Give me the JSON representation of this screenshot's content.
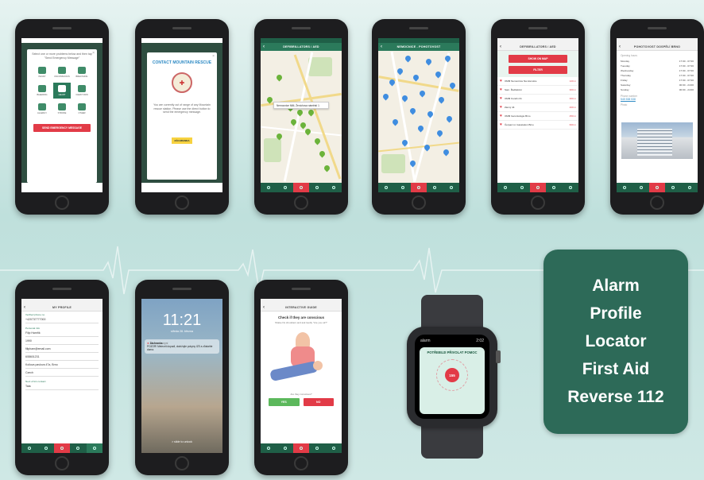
{
  "features": [
    "Alarm",
    "Profile",
    "Locator",
    "First Aid",
    "Reverse 112"
  ],
  "colors": {
    "accent_green": "#2b7a5b",
    "dark_green": "#1f5f47",
    "alert_red": "#e23b47",
    "card": "#2d6a58"
  },
  "tabbar": [
    "FIRST AID",
    "LOCATOR",
    "ALARM",
    "INFO",
    "MY PROFILE"
  ],
  "phone1": {
    "message": "Select one or more problems below and then tap \"Send Emergency Message\"",
    "icons": [
      "INJURY",
      "UNCONSCIOUS",
      "BREATHING",
      "BLEEDING",
      "HEART",
      "CHEST PAIN",
      "ALLERGY",
      "STROKE",
      "OTHER"
    ],
    "send_button": "SEND EMERGENCY MESSAGE"
  },
  "phone2": {
    "title": "CONTACT MOUNTAIN RESCUE",
    "body": "You are currently out of range of any Mountain rescue station. Please use the direct button to send the emergency message.",
    "logo": "ZÁCHRANKA"
  },
  "phone3": {
    "header": "DEFIBRILLATORS / AED",
    "popup": "Nemocnice Milli, Ženíchova náměstí 1"
  },
  "phone4": {
    "header": "NEMOCNICE - POHOTOVOST"
  },
  "phone5": {
    "header": "DEFIBRILLATORS / AED",
    "btn_map": "SHOW ON MAP",
    "btn_filter": "FILTER",
    "rows": [
      {
        "name": "OMM Nemocnice Na Homolce",
        "dist": "120 m"
      },
      {
        "name": "Sam. Ředitelství",
        "dist": "300 m"
      },
      {
        "name": "OMM Kundín 01",
        "dist": "360 m"
      },
      {
        "name": "Zanný 44",
        "dist": "400 m"
      },
      {
        "name": "OMM Gerontologie Brno",
        "dist": "450 m"
      },
      {
        "name": "Čerpací st. Gasstation Brno",
        "dist": "600 m"
      }
    ]
  },
  "phone6": {
    "header": "POHOTOVOST DOSPĚLÍ BRNO",
    "opening_label": "Opening hours",
    "hours": [
      {
        "day": "Monday",
        "time": "17:00 - 07:00"
      },
      {
        "day": "Tuesday",
        "time": "17:00 - 07:00"
      },
      {
        "day": "Wednesday",
        "time": "17:00 - 07:00"
      },
      {
        "day": "Thursday",
        "time": "17:00 - 07:00"
      },
      {
        "day": "Friday",
        "time": "17:00 - 07:00"
      },
      {
        "day": "Saturday",
        "time": "00:00 - 24:00"
      },
      {
        "day": "Sunday",
        "time": "00:00 - 24:00"
      }
    ],
    "phone_label": "Phone number",
    "phone": "545 538 538",
    "photo_label": "Photo"
  },
  "phone7": {
    "header": "MY PROFILE",
    "verified_label": "Verified phone no.",
    "verified_value": "+420737777000",
    "personal_label": "Personal info",
    "name": "Filip Hamřík",
    "year": "1990",
    "email": "filipham@email.com",
    "phone": "608601231",
    "address": "Koliova pavlova 47a, Brno",
    "language": "Czech",
    "contact_label": "Next of kin contact",
    "contact_value": "Tata"
  },
  "phone8": {
    "time": "11:21",
    "date": "středa 28. března",
    "notif_app": "Záchranka",
    "notif_when": "nyní",
    "notif_text": "POZOR! Meteorit dopadl, dodržujte pokyny IZS a zůstaňte doma.",
    "slide": "> slide to unlock"
  },
  "phone9": {
    "header": "INTERACTIVE GUIDE",
    "question": "Check if they are conscious",
    "sub": "Shake his shoulders and ask loudly \"Are you ok?\"",
    "prompt": "Are they conscious?",
    "yes": "YES",
    "no": "NO"
  },
  "watch": {
    "app": "alarm",
    "time": "2:02",
    "title": "POTŘEBUJI PŘIVOLAT POMOC",
    "button": "155"
  }
}
